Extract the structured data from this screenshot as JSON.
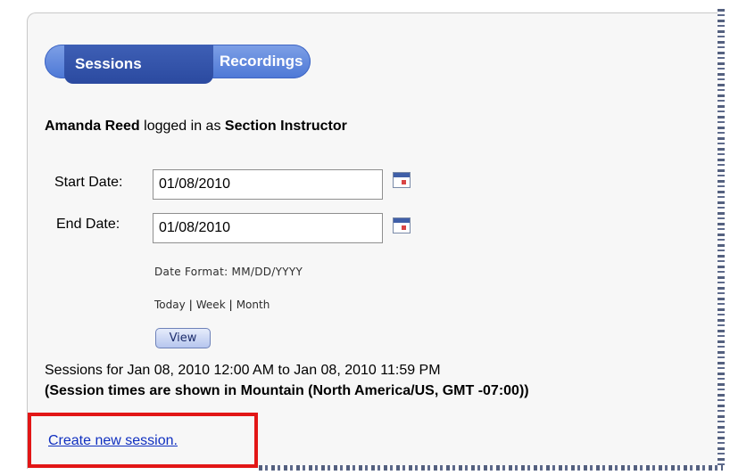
{
  "tabs": {
    "sessions": "Sessions",
    "recordings": "Recordings"
  },
  "user": {
    "name": "Amanda Reed",
    "middle_text": "logged in as",
    "role": "Section Instructor"
  },
  "form": {
    "start_date_label": "Start Date:",
    "start_date_value": "01/08/2010",
    "end_date_label": "End Date:",
    "end_date_value": "01/08/2010",
    "date_format": "Date Format: MM/DD/YYYY",
    "range_links": {
      "today": "Today",
      "week": "Week",
      "month": "Month"
    },
    "view_button": "View"
  },
  "sessions_summary": "Sessions for Jan 08, 2010 12:00 AM to Jan 08, 2010 11:59 PM",
  "timezone_note": "(Session times are shown in Mountain (North America/US, GMT -07:00))",
  "create_link": "Create new session.",
  "colors": {
    "tab_active": "#2b4aa0",
    "tab_bar": "#4d78d6",
    "link": "#1030c0",
    "highlight_border": "#e21616"
  },
  "icons": {
    "calendar": "calendar-icon"
  }
}
